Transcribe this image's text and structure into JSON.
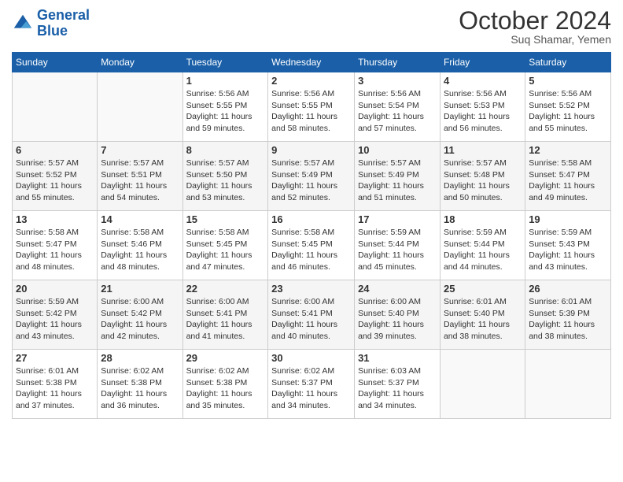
{
  "logo": {
    "line1": "General",
    "line2": "Blue"
  },
  "title": "October 2024",
  "subtitle": "Suq Shamar, Yemen",
  "days_of_week": [
    "Sunday",
    "Monday",
    "Tuesday",
    "Wednesday",
    "Thursday",
    "Friday",
    "Saturday"
  ],
  "weeks": [
    [
      {
        "day": "",
        "info": ""
      },
      {
        "day": "",
        "info": ""
      },
      {
        "day": "1",
        "info": "Sunrise: 5:56 AM\nSunset: 5:55 PM\nDaylight: 11 hours and 59 minutes."
      },
      {
        "day": "2",
        "info": "Sunrise: 5:56 AM\nSunset: 5:55 PM\nDaylight: 11 hours and 58 minutes."
      },
      {
        "day": "3",
        "info": "Sunrise: 5:56 AM\nSunset: 5:54 PM\nDaylight: 11 hours and 57 minutes."
      },
      {
        "day": "4",
        "info": "Sunrise: 5:56 AM\nSunset: 5:53 PM\nDaylight: 11 hours and 56 minutes."
      },
      {
        "day": "5",
        "info": "Sunrise: 5:56 AM\nSunset: 5:52 PM\nDaylight: 11 hours and 55 minutes."
      }
    ],
    [
      {
        "day": "6",
        "info": "Sunrise: 5:57 AM\nSunset: 5:52 PM\nDaylight: 11 hours and 55 minutes."
      },
      {
        "day": "7",
        "info": "Sunrise: 5:57 AM\nSunset: 5:51 PM\nDaylight: 11 hours and 54 minutes."
      },
      {
        "day": "8",
        "info": "Sunrise: 5:57 AM\nSunset: 5:50 PM\nDaylight: 11 hours and 53 minutes."
      },
      {
        "day": "9",
        "info": "Sunrise: 5:57 AM\nSunset: 5:49 PM\nDaylight: 11 hours and 52 minutes."
      },
      {
        "day": "10",
        "info": "Sunrise: 5:57 AM\nSunset: 5:49 PM\nDaylight: 11 hours and 51 minutes."
      },
      {
        "day": "11",
        "info": "Sunrise: 5:57 AM\nSunset: 5:48 PM\nDaylight: 11 hours and 50 minutes."
      },
      {
        "day": "12",
        "info": "Sunrise: 5:58 AM\nSunset: 5:47 PM\nDaylight: 11 hours and 49 minutes."
      }
    ],
    [
      {
        "day": "13",
        "info": "Sunrise: 5:58 AM\nSunset: 5:47 PM\nDaylight: 11 hours and 48 minutes."
      },
      {
        "day": "14",
        "info": "Sunrise: 5:58 AM\nSunset: 5:46 PM\nDaylight: 11 hours and 48 minutes."
      },
      {
        "day": "15",
        "info": "Sunrise: 5:58 AM\nSunset: 5:45 PM\nDaylight: 11 hours and 47 minutes."
      },
      {
        "day": "16",
        "info": "Sunrise: 5:58 AM\nSunset: 5:45 PM\nDaylight: 11 hours and 46 minutes."
      },
      {
        "day": "17",
        "info": "Sunrise: 5:59 AM\nSunset: 5:44 PM\nDaylight: 11 hours and 45 minutes."
      },
      {
        "day": "18",
        "info": "Sunrise: 5:59 AM\nSunset: 5:44 PM\nDaylight: 11 hours and 44 minutes."
      },
      {
        "day": "19",
        "info": "Sunrise: 5:59 AM\nSunset: 5:43 PM\nDaylight: 11 hours and 43 minutes."
      }
    ],
    [
      {
        "day": "20",
        "info": "Sunrise: 5:59 AM\nSunset: 5:42 PM\nDaylight: 11 hours and 43 minutes."
      },
      {
        "day": "21",
        "info": "Sunrise: 6:00 AM\nSunset: 5:42 PM\nDaylight: 11 hours and 42 minutes."
      },
      {
        "day": "22",
        "info": "Sunrise: 6:00 AM\nSunset: 5:41 PM\nDaylight: 11 hours and 41 minutes."
      },
      {
        "day": "23",
        "info": "Sunrise: 6:00 AM\nSunset: 5:41 PM\nDaylight: 11 hours and 40 minutes."
      },
      {
        "day": "24",
        "info": "Sunrise: 6:00 AM\nSunset: 5:40 PM\nDaylight: 11 hours and 39 minutes."
      },
      {
        "day": "25",
        "info": "Sunrise: 6:01 AM\nSunset: 5:40 PM\nDaylight: 11 hours and 38 minutes."
      },
      {
        "day": "26",
        "info": "Sunrise: 6:01 AM\nSunset: 5:39 PM\nDaylight: 11 hours and 38 minutes."
      }
    ],
    [
      {
        "day": "27",
        "info": "Sunrise: 6:01 AM\nSunset: 5:38 PM\nDaylight: 11 hours and 37 minutes."
      },
      {
        "day": "28",
        "info": "Sunrise: 6:02 AM\nSunset: 5:38 PM\nDaylight: 11 hours and 36 minutes."
      },
      {
        "day": "29",
        "info": "Sunrise: 6:02 AM\nSunset: 5:38 PM\nDaylight: 11 hours and 35 minutes."
      },
      {
        "day": "30",
        "info": "Sunrise: 6:02 AM\nSunset: 5:37 PM\nDaylight: 11 hours and 34 minutes."
      },
      {
        "day": "31",
        "info": "Sunrise: 6:03 AM\nSunset: 5:37 PM\nDaylight: 11 hours and 34 minutes."
      },
      {
        "day": "",
        "info": ""
      },
      {
        "day": "",
        "info": ""
      }
    ]
  ]
}
